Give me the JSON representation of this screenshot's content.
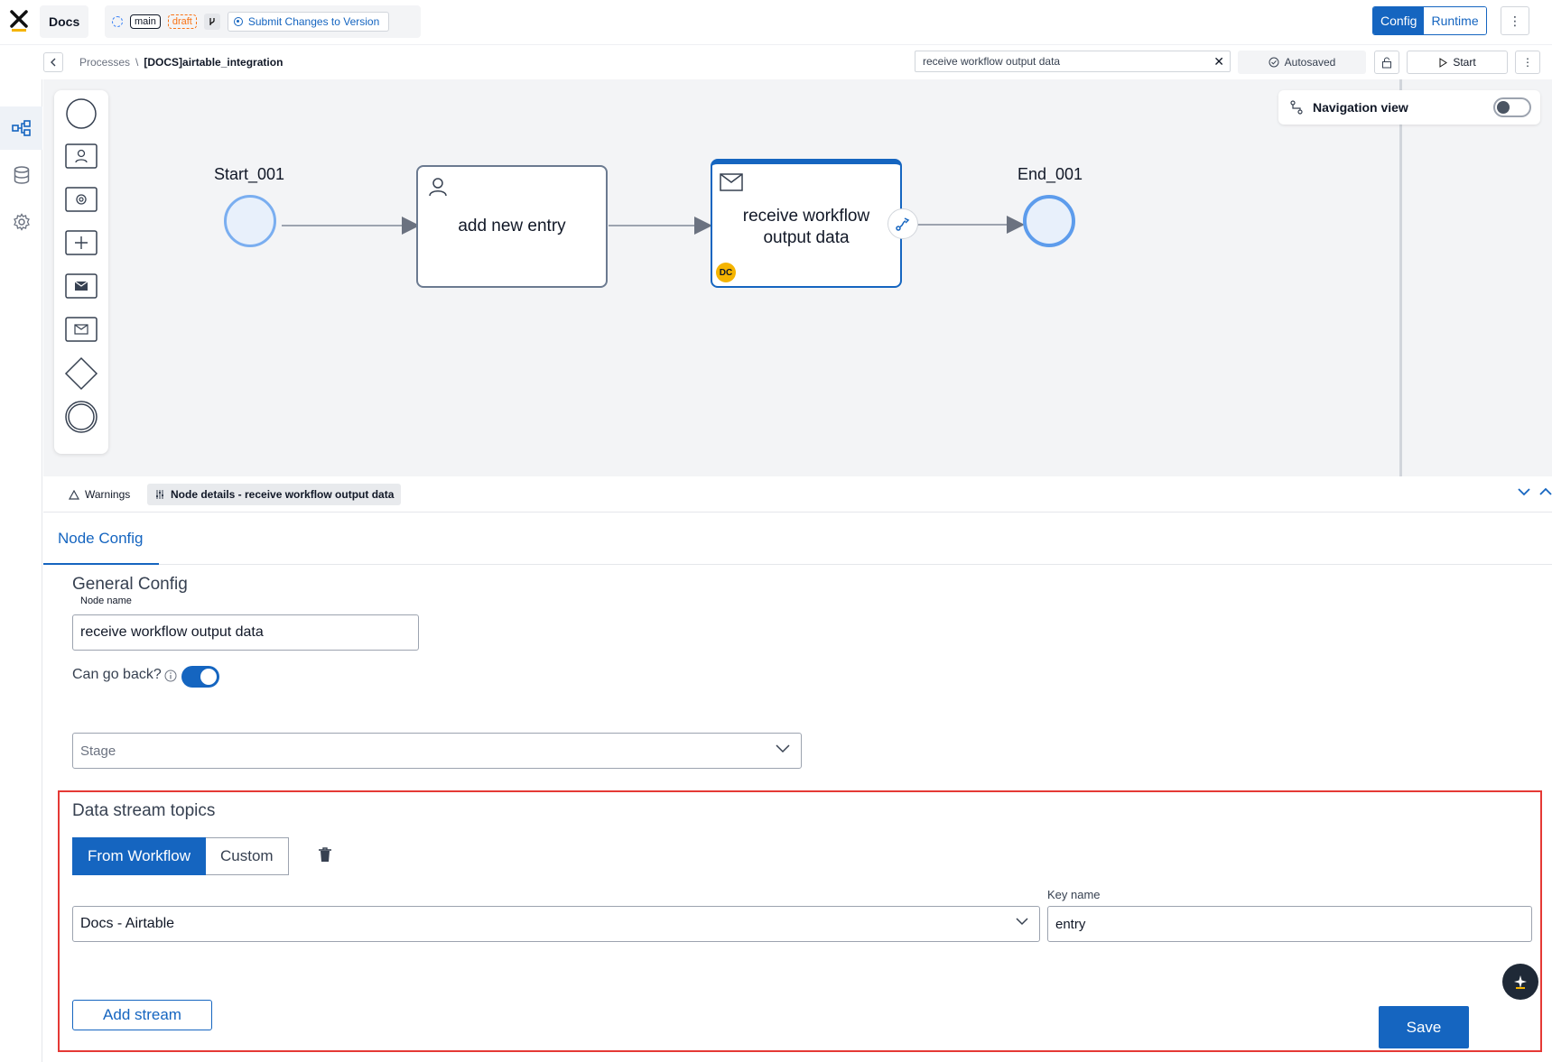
{
  "header": {
    "project_name": "Docs",
    "branch": "main",
    "status": "draft",
    "submit_label": "Submit Changes to Version",
    "mode_config": "Config",
    "mode_runtime": "Runtime"
  },
  "subbar": {
    "breadcrumb_root": "Processes",
    "breadcrumb_sep": "\\",
    "breadcrumb_current": "[DOCS]airtable_integration",
    "search_value": "receive workflow output data",
    "autosaved_label": "Autosaved",
    "start_label": "Start"
  },
  "canvas": {
    "navigation_view_label": "Navigation view",
    "start_event_label": "Start_001",
    "task1_label": "add new entry",
    "task2_label": "receive workflow output data",
    "task2_badge": "DC",
    "end_event_label": "End_001"
  },
  "panel": {
    "tab_warnings": "Warnings",
    "tab_node_details": "Node details - receive workflow output data",
    "config_tab": "Node Config",
    "general_config_title": "General Config",
    "node_name_label": "Node name",
    "node_name_value": "receive workflow output data",
    "can_go_back_label": "Can go back?",
    "stage_placeholder": "Stage",
    "data_stream_title": "Data stream topics",
    "seg_from_workflow": "From Workflow",
    "seg_custom": "Custom",
    "stream_select_value": "Docs - Airtable",
    "key_name_label": "Key name",
    "key_name_value": "entry",
    "add_stream_label": "Add stream",
    "save_label": "Save"
  },
  "colors": {
    "accent": "#1565c0",
    "highlight": "#e53935",
    "badge": "#f5b400",
    "draft": "#f97316"
  }
}
